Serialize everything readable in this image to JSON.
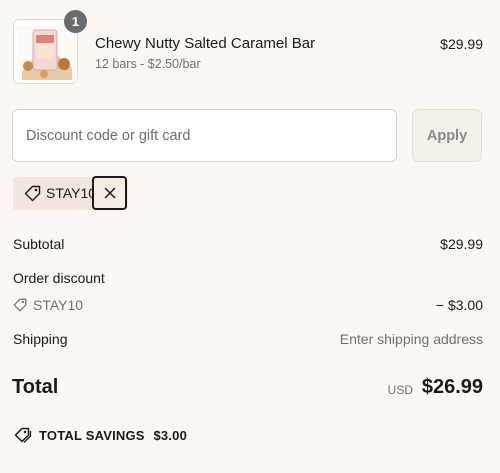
{
  "item": {
    "quantity": "1",
    "name": "Chewy Nutty Salted Caramel Bar",
    "variant": "12 bars - $2.50/bar",
    "price": "$29.99",
    "image_icon": "product-thumbnail"
  },
  "discount": {
    "placeholder": "Discount code or gift card",
    "value": "",
    "apply_label": "Apply",
    "applied_code": "STAY10"
  },
  "summary": {
    "subtotal_label": "Subtotal",
    "subtotal_value": "$29.99",
    "order_discount_label": "Order discount",
    "discount_code": "STAY10",
    "discount_value": "− $3.00",
    "shipping_label": "Shipping",
    "shipping_value": "Enter shipping address",
    "total_label": "Total",
    "currency": "USD",
    "total_value": "$26.99",
    "savings_label": "TOTAL SAVINGS",
    "savings_value": "$3.00"
  },
  "colors": {
    "background": "#fdf7f3",
    "chip_background": "#f1e6df",
    "badge": "#6b6b6b"
  }
}
